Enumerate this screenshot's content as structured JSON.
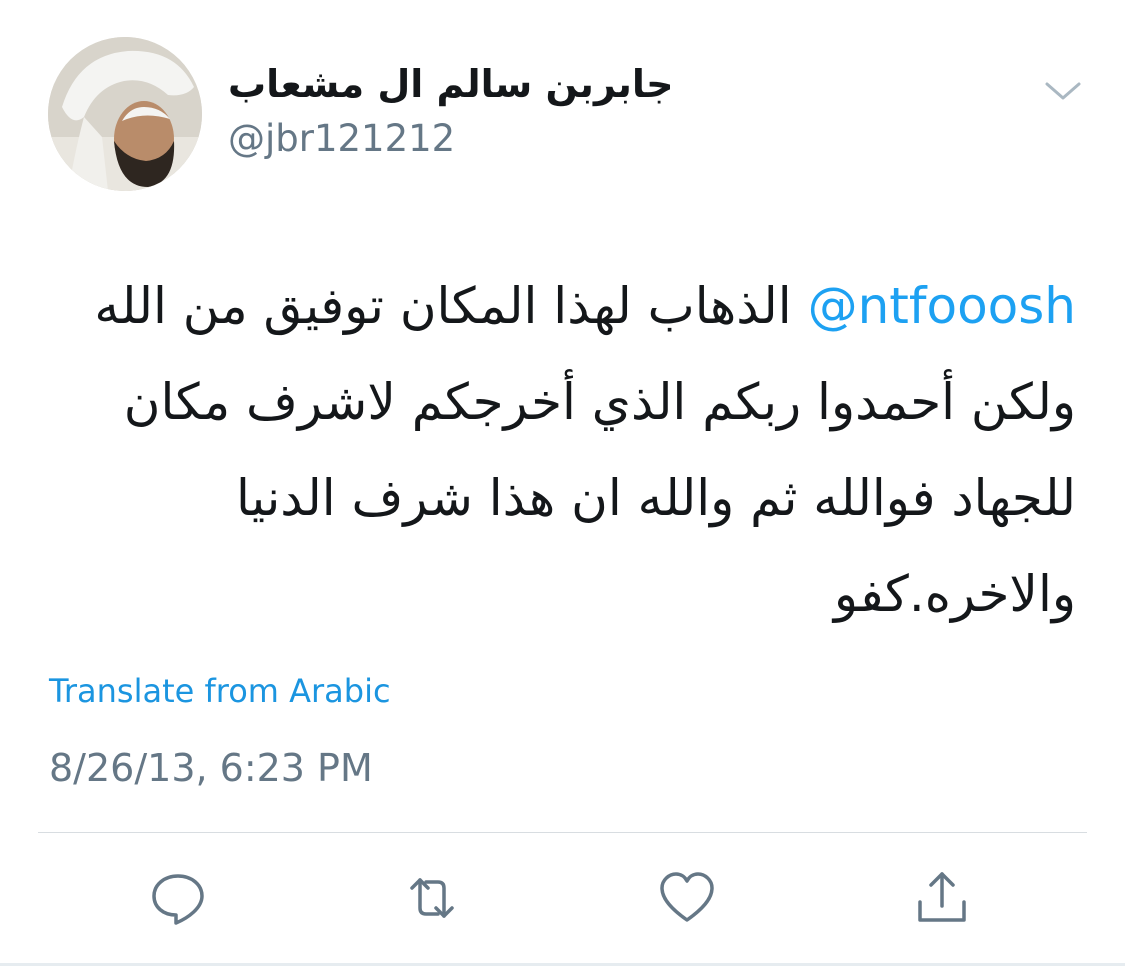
{
  "user": {
    "display_name": "جابربن سالم ال مشعاب",
    "handle": "@jbr121212",
    "avatar_icon": "user-avatar-photo"
  },
  "tweet": {
    "mention": "@ntfooosh",
    "text_line1_rest": "الذهاب لهذا المكان توفيق من الله",
    "text_line2": "ولكن أحمدوا ربكم الذي أخرجكم لاشرف مكان",
    "text_line3": "للجهاد فوالله ثم والله ان هذا شرف الدنيا",
    "text_line4": "والاخره.كفو",
    "translate_label": "Translate from Arabic",
    "timestamp": "8/26/13, 6:23 PM"
  },
  "actions": {
    "reply_icon": "reply-icon",
    "retweet_icon": "retweet-icon",
    "like_icon": "like-heart-icon",
    "share_icon": "share-icon"
  },
  "colors": {
    "link": "#1da1f2",
    "secondary_text": "#657786",
    "primary_text": "#14171a",
    "divider": "#d8dde1"
  }
}
